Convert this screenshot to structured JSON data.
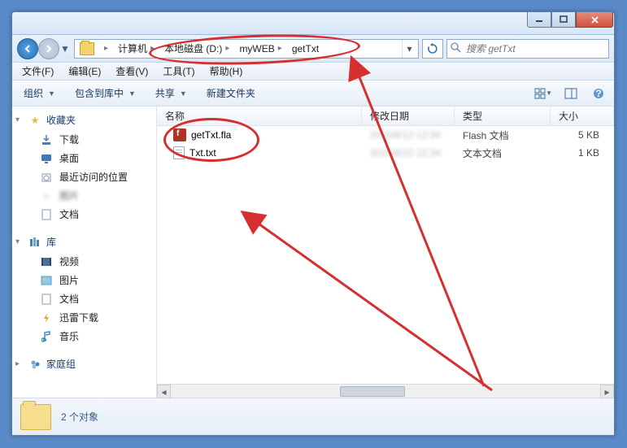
{
  "breadcrumb": {
    "computer": "计算机",
    "drive": "本地磁盘 (D:)",
    "folder1": "myWEB",
    "folder2": "getTxt"
  },
  "search": {
    "placeholder": "搜索 getTxt"
  },
  "menubar": {
    "file": "文件(F)",
    "edit": "编辑(E)",
    "view": "查看(V)",
    "tools": "工具(T)",
    "help": "帮助(H)"
  },
  "toolbar": {
    "organize": "组织",
    "include": "包含到库中",
    "share": "共享",
    "newfolder": "新建文件夹"
  },
  "sidebar": {
    "favorites": "收藏夹",
    "fav_items": [
      "下载",
      "桌面",
      "最近访问的位置"
    ],
    "fav_blur": "图片",
    "fav_docs": "文档",
    "library": "库",
    "lib_items": [
      "视频",
      "图片",
      "文档",
      "迅雷下载",
      "音乐"
    ],
    "homegroup": "家庭组"
  },
  "columns": {
    "name": "名称",
    "date": "修改日期",
    "type": "类型",
    "size": "大小"
  },
  "files": [
    {
      "name": "getTxt.fla",
      "type": "Flash 文档",
      "size": "5 KB",
      "kind": "fla"
    },
    {
      "name": "Txt.txt",
      "type": "文本文档",
      "size": "1 KB",
      "kind": "txt"
    }
  ],
  "status": {
    "text": "2 个对象"
  }
}
